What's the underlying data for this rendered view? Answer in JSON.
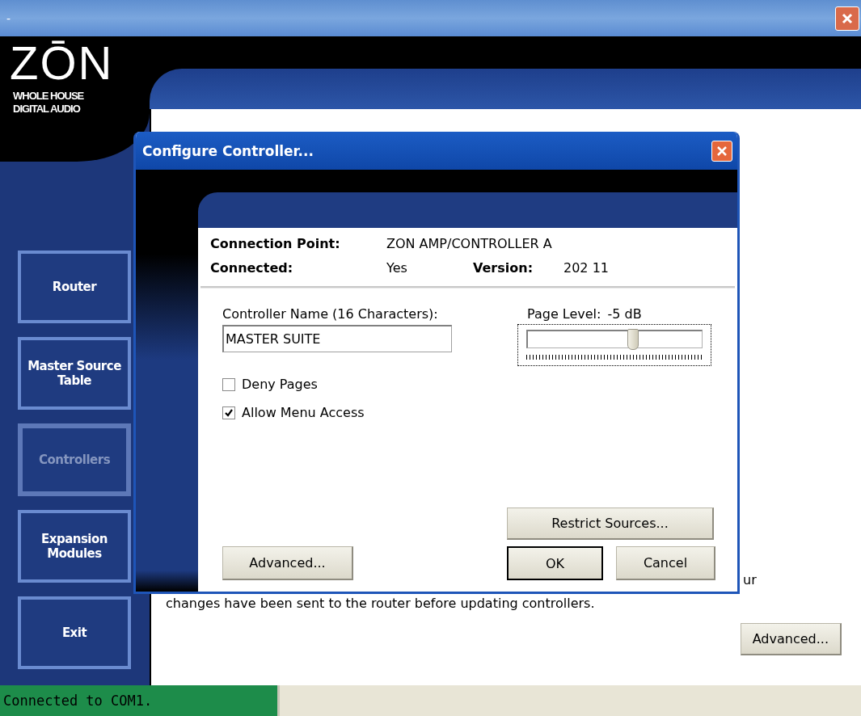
{
  "window": {
    "title": "-"
  },
  "logo": {
    "name": "ZŌN",
    "tagline": [
      "WHOLE HOUSE",
      "DIGITAL AUDIO"
    ]
  },
  "sidebar": {
    "items": [
      {
        "label": "Router",
        "selected": false
      },
      {
        "label": "Master Source Table",
        "selected": false
      },
      {
        "label": "Controllers",
        "selected": true
      },
      {
        "label": "Expansion Modules",
        "selected": false
      },
      {
        "label": "Exit",
        "selected": false
      }
    ]
  },
  "content": {
    "hidden_line_end": "ur",
    "line": "changes have been sent to the router before updating controllers.",
    "button": "Advanced..."
  },
  "dialog": {
    "title": "Configure Controller...",
    "connection_point_label": "Connection Point:",
    "connection_point": "ZON AMP/CONTROLLER A",
    "connected_label": "Connected:",
    "connected": "Yes",
    "version_label": "Version:",
    "version": "202 11",
    "name_label": "Controller Name (16 Characters):",
    "name_value": "MASTER SUITE",
    "page_level_label": "Page Level:",
    "page_level_reading": "-5 dB",
    "page_level": {
      "level": 0.6
    },
    "checkboxes": [
      {
        "label": "Deny Pages",
        "checked": false
      },
      {
        "label": "Allow Menu Access",
        "checked": true
      }
    ],
    "restrict_button": "Restrict Sources...",
    "advanced_button": "Advanced...",
    "ok_button": "OK",
    "cancel_button": "Cancel"
  },
  "status_bar": {
    "connection": "Connected to COM1."
  }
}
